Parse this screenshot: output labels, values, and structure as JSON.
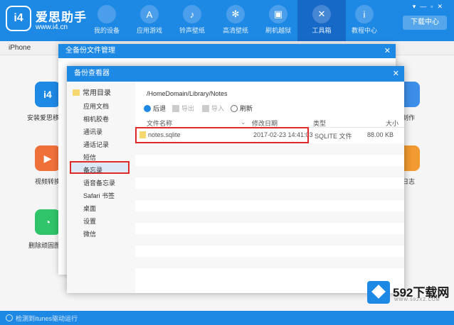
{
  "app": {
    "name": "爱思助手",
    "url": "www.i4.cn",
    "logo_text": "i4",
    "top_right_button": "下载中心"
  },
  "nav": [
    {
      "label": "我的设备",
      "icon": "apple-icon"
    },
    {
      "label": "应用游戏",
      "icon": "app-store-icon"
    },
    {
      "label": "铃声壁纸",
      "icon": "bell-icon"
    },
    {
      "label": "高清壁纸",
      "icon": "snowflake-icon"
    },
    {
      "label": "刷机越狱",
      "icon": "box-icon"
    },
    {
      "label": "工具箱",
      "icon": "tools-icon"
    },
    {
      "label": "教程中心",
      "icon": "info-icon"
    }
  ],
  "device": {
    "label": "iPhone"
  },
  "background_tools": [
    {
      "label": "安装爱思移动端",
      "glyph": "i4",
      "color": "#1e88e5"
    },
    {
      "label": "视频转换",
      "glyph": "▶",
      "color": "#f0703a"
    },
    {
      "label": "删除顽固图标",
      "glyph": "◔",
      "color": "#2fc46a"
    },
    {
      "label": "制作",
      "glyph": "",
      "color": "#3c8ee8"
    },
    {
      "label": "日志",
      "glyph": "",
      "color": "#f09a30"
    }
  ],
  "file_dialog": {
    "title": "全备份文件管理"
  },
  "backup_dialog": {
    "title": "备份查看器",
    "sidebar_header": "常用目录",
    "sidebar_items": [
      "应用文档",
      "相机胶卷",
      "通讯录",
      "通话记录",
      "短信",
      "备忘录",
      "语音备忘录",
      "Safari 书签",
      "桌面",
      "设置",
      "微信"
    ],
    "selected_index": 5,
    "path": "/HomeDomain/Library/Notes",
    "toolbar": {
      "back": "后退",
      "export": "导出",
      "import": "导入",
      "refresh": "刷新"
    },
    "columns": {
      "name": "文件名称",
      "date": "修改日期",
      "type": "类型",
      "size": "大小"
    },
    "file": {
      "name": "notes.sqlite",
      "date": "2017-02-23 14:41:03",
      "type": "SQLITE 文件",
      "size": "88.00 KB"
    }
  },
  "status": {
    "text": "检测到itunes驱动运行"
  },
  "watermark": {
    "text": "592下载网",
    "sub": "WWW.592XZ.COM"
  }
}
